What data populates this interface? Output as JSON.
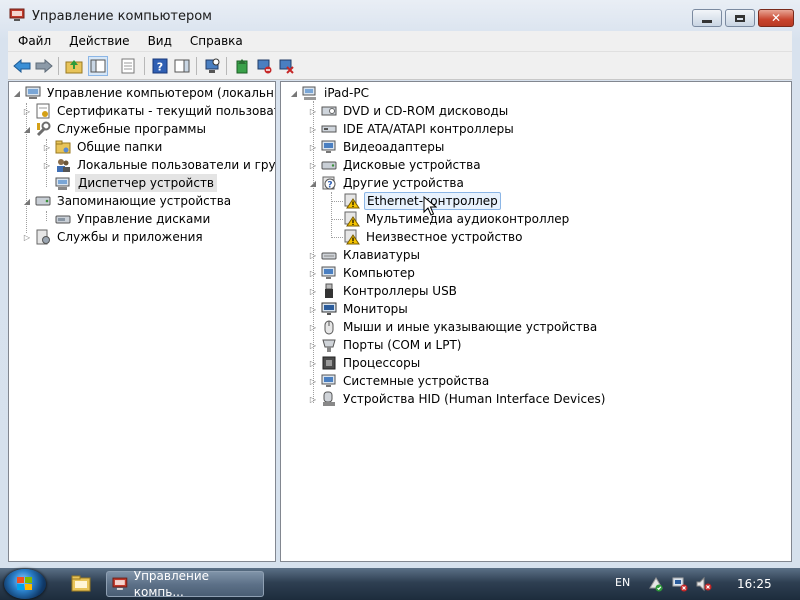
{
  "window": {
    "title": "Управление компьютером"
  },
  "menu": [
    "Файл",
    "Действие",
    "Вид",
    "Справка"
  ],
  "left_tree": [
    {
      "label": "Управление компьютером (локальным)",
      "icon": "computer-management-icon"
    },
    {
      "label": "Сертификаты - текущий пользователь",
      "icon": "certificate-icon"
    },
    {
      "label": "Служебные программы",
      "icon": "tools-icon"
    },
    {
      "label": "Общие папки",
      "icon": "shared-folder-icon"
    },
    {
      "label": "Локальные пользователи и группы",
      "icon": "users-icon"
    },
    {
      "label": "Диспетчер устройств",
      "icon": "device-manager-icon",
      "selected": true
    },
    {
      "label": "Запоминающие устройства",
      "icon": "storage-icon"
    },
    {
      "label": "Управление дисками",
      "icon": "disk-management-icon"
    },
    {
      "label": "Службы и приложения",
      "icon": "services-icon"
    }
  ],
  "right_tree": {
    "root": "iPad-PC",
    "categories": [
      "DVD и CD-ROM дисководы",
      "IDE ATA/ATAPI контроллеры",
      "Видеоадаптеры",
      "Дисковые устройства",
      "Другие устройства",
      "Клавиатуры",
      "Компьютер",
      "Контроллеры USB",
      "Мониторы",
      "Мыши и иные указывающие устройства",
      "Порты (COM и LPT)",
      "Процессоры",
      "Системные устройства",
      "Устройства HID (Human Interface Devices)"
    ],
    "other_devices": [
      "Ethernet-контроллер",
      "Мультимедиа аудиоконтроллер",
      "Неизвестное устройство"
    ]
  },
  "taskbar": {
    "task_label": "Управление компь...",
    "language": "EN",
    "time": "16:25"
  },
  "colors": {
    "selection_blue": "#e8f2fd",
    "selection_border": "#8cb6e6",
    "warning_yellow": "#f5c400",
    "close_red": "#c8442d"
  }
}
